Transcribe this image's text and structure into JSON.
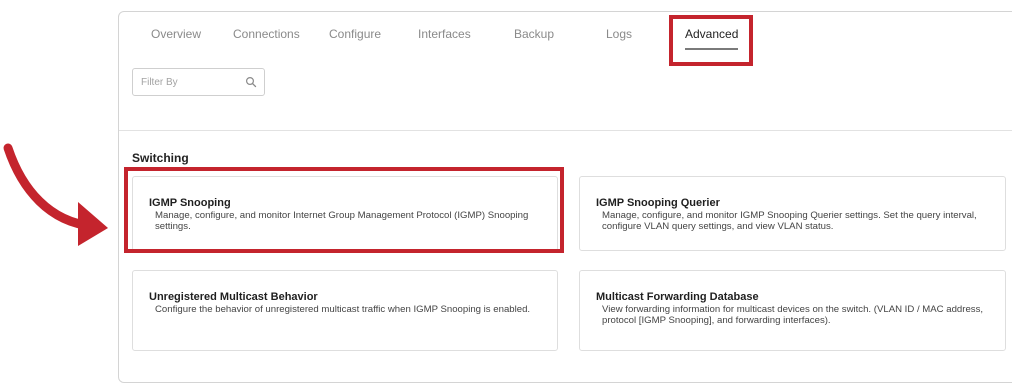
{
  "tabs": [
    "Overview",
    "Connections",
    "Configure",
    "Interfaces",
    "Backup",
    "Logs",
    "Advanced"
  ],
  "active_tab": "Advanced",
  "filter": {
    "placeholder": "Filter By",
    "value": ""
  },
  "section_title": "Switching",
  "cards": [
    {
      "title": "IGMP Snooping",
      "description": "Manage, configure, and monitor Internet Group Management Protocol (IGMP) Snooping settings."
    },
    {
      "title": "IGMP Snooping Querier",
      "description": "Manage, configure, and monitor IGMP Snooping Querier settings. Set the query interval, configure VLAN query settings, and view VLAN status."
    },
    {
      "title": "Unregistered Multicast Behavior",
      "description": "Configure the behavior of unregistered multicast traffic when IGMP Snooping is enabled."
    },
    {
      "title": "Multicast Forwarding Database",
      "description": "View forwarding information for multicast devices on the switch. (VLAN ID / MAC address, protocol [IGMP Snooping], and forwarding interfaces)."
    }
  ],
  "colors": {
    "highlight": "#c4242d",
    "border": "#d4d4d4",
    "muted_text": "#8a8a8a"
  },
  "icons": {
    "search": "search-icon",
    "pointer_arrow": "curved-arrow-icon"
  }
}
